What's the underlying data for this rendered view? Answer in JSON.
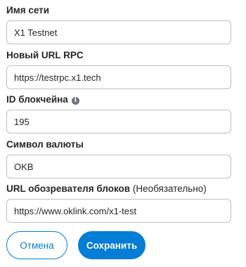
{
  "form": {
    "network_name": {
      "label": "Имя сети",
      "value": "X1 Testnet"
    },
    "rpc_url": {
      "label": "Новый URL RPC",
      "value": "https://testrpc.x1.tech"
    },
    "chain_id": {
      "label": "ID блокчейна",
      "value": "195",
      "info_icon": "info-icon"
    },
    "currency_symbol": {
      "label": "Символ валюты",
      "value": "OKB"
    },
    "explorer_url": {
      "label": "URL обозревателя блоков",
      "optional": "(Необязательно)",
      "value": "https://www.oklink.com/x1-test"
    }
  },
  "actions": {
    "cancel_label": "Отмена",
    "save_label": "Сохранить"
  },
  "colors": {
    "accent": "#037dd6",
    "text": "#24272a",
    "border": "#bbc0c5"
  }
}
